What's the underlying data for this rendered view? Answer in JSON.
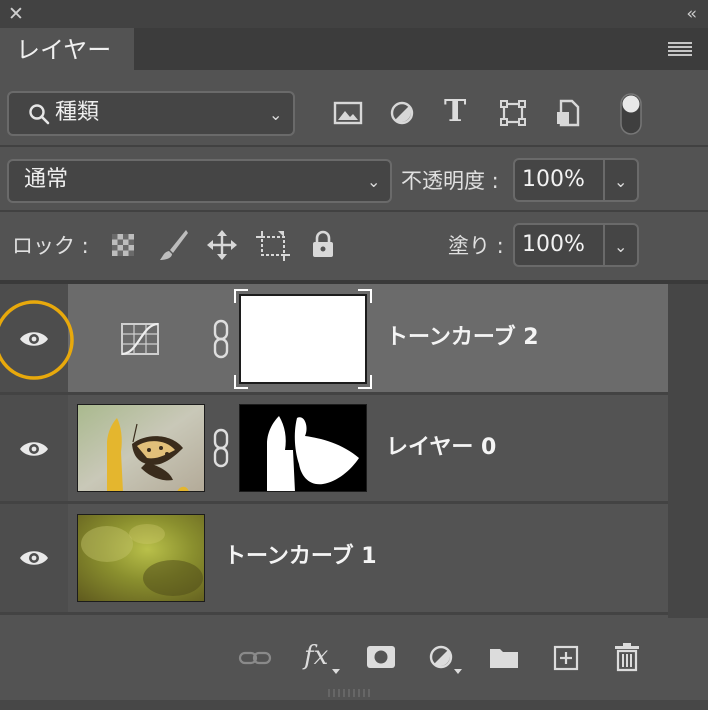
{
  "panel": {
    "close_glyph": "✕",
    "collapse_glyph": "‹‹",
    "tab_label": "レイヤー"
  },
  "filter": {
    "value": "種類",
    "icons": [
      "image-filter-icon",
      "adjustment-filter-icon",
      "type-filter-icon",
      "shape-filter-icon",
      "smart-object-filter-icon",
      "filter-toggle-icon"
    ],
    "type_glyph": "T"
  },
  "blend": {
    "mode": "通常",
    "opacity_label": "不透明度 :",
    "opacity_value": "100%"
  },
  "lock": {
    "label": "ロック :",
    "fill_label": "塗り :",
    "fill_value": "100%"
  },
  "layers": [
    {
      "name": "トーンカーブ 2",
      "visible": true,
      "selected": true
    },
    {
      "name": "レイヤー 0",
      "visible": true,
      "selected": false
    },
    {
      "name": "トーンカーブ 1",
      "visible": true,
      "selected": false
    }
  ],
  "bottom_toolbar": {
    "fx_label": "fx"
  },
  "colors": {
    "panel_bg": "#535353",
    "selected_row": "#6b6b6b",
    "highlight_ring": "#e8a90c"
  }
}
